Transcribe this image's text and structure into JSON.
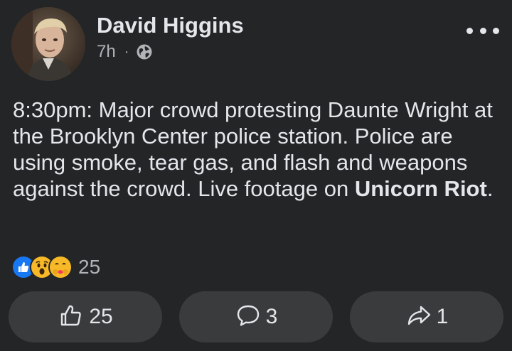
{
  "post": {
    "author": "David Higgins",
    "time": "7h",
    "separator": "·",
    "privacy_icon": "globe-icon",
    "more_icon": "more-horizontal-icon",
    "text_before_link": "8:30pm: Major crowd protesting Daunte Wright at the Brooklyn Center police station. Police are using smoke, tear gas, and flash and weapons against the crowd. Live footage on ",
    "link_text": "Unicorn Riot",
    "text_after_link": "."
  },
  "reactions": {
    "icons": [
      "like-reaction-icon",
      "wow-reaction-icon",
      "care-reaction-icon"
    ],
    "count": "25"
  },
  "actions": {
    "like": {
      "icon": "thumbs-up-icon",
      "count": "25"
    },
    "comment": {
      "icon": "comment-icon",
      "count": "3"
    },
    "share": {
      "icon": "share-icon",
      "count": "1"
    }
  },
  "colors": {
    "background": "#242526",
    "button_bg": "#3a3b3c",
    "text_primary": "#e4e6eb",
    "text_secondary": "#b0b3b8",
    "like_blue": "#1877f2",
    "wow_yellow": "#f7b928",
    "care_red": "#f33e58"
  }
}
